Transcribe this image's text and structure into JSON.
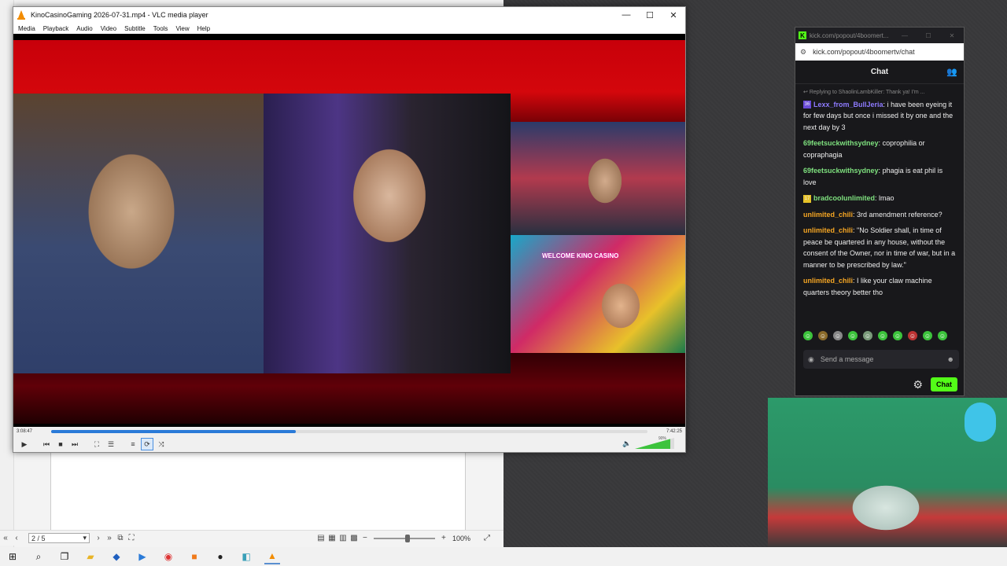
{
  "vlc": {
    "title": "KinoCasinoGaming 2026-07-31.mp4 - VLC media player",
    "menu": [
      "Media",
      "Playback",
      "Audio",
      "Video",
      "Subtitle",
      "Tools",
      "View",
      "Help"
    ],
    "elapsed": "3:08:47",
    "duration": "7:42:25",
    "progress_fraction": 0.41,
    "volume": "90%",
    "overlay_text": "WELCOME KINO CASINO"
  },
  "chat": {
    "tab_title": "kick.com/popout/4boomert...",
    "url": "kick.com/popout/4boomertv/chat",
    "header": "Chat",
    "reply_to": "Replying to ShaolinLambKiller: Thank ya! I'm ...",
    "messages": [
      {
        "user": "Lexx_from_BullJeria",
        "text": "i have been eyeing it for few days but once i missed it by one and the next day by 3",
        "color": "#8e7bff",
        "badge": "36",
        "badge_color": "#6a4bd8"
      },
      {
        "user": "69feetsuckwithsydney",
        "text": "coprophilia or copraphagia",
        "color": "#7ee07e"
      },
      {
        "user": "69feetsuckwithsydney",
        "text": "phagia is eat phil is love",
        "color": "#7ee07e"
      },
      {
        "user": "bradcoolunlimited",
        "text": "lmao",
        "color": "#7ee07e",
        "badge": "17",
        "badge_color": "#e6c229"
      },
      {
        "user": "unlimited_chili",
        "text": "3rd amendment reference?",
        "color": "#f6a623"
      },
      {
        "user": "unlimited_chili",
        "text": "\"No Soldier shall, in time of peace be quartered in any house, without the consent of the Owner, nor in time of war, but in a manner to be prescribed by law.\"",
        "color": "#f6a623"
      },
      {
        "user": "unlimited_chili",
        "text": "I like your claw machine quarters theory better tho",
        "color": "#f6a623"
      }
    ],
    "send_placeholder": "Send a message",
    "chat_button": "Chat"
  },
  "doc": {
    "page_indicator": "2 / 5",
    "zoom": "100%"
  },
  "colors": {
    "kick_green": "#53fc18",
    "vlc_seek": "#2a7ad8"
  }
}
